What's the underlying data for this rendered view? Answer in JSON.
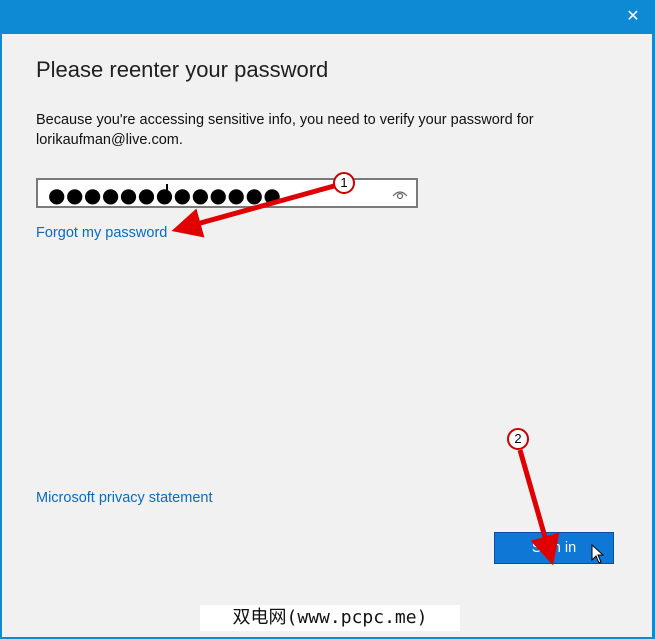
{
  "window": {
    "close_glyph": "✕"
  },
  "dialog": {
    "title": "Please reenter your password",
    "description": "Because you're accessing sensitive info, you need to verify your password for lorikaufman@live.com.",
    "password_value": "●●●●●●●●●●●●●",
    "forgot_link": "Forgot my password",
    "privacy_link": "Microsoft privacy statement",
    "signin_label": "Sign in"
  },
  "annotations": {
    "callout_1": "1",
    "callout_2": "2",
    "arrow_color": "#e00000"
  },
  "watermark": "双电网(www.pcpc.me)",
  "colors": {
    "accent": "#0f78d6",
    "titlebar": "#0e8ad5",
    "link": "#0a6bc1",
    "background": "#f1f1f1"
  }
}
